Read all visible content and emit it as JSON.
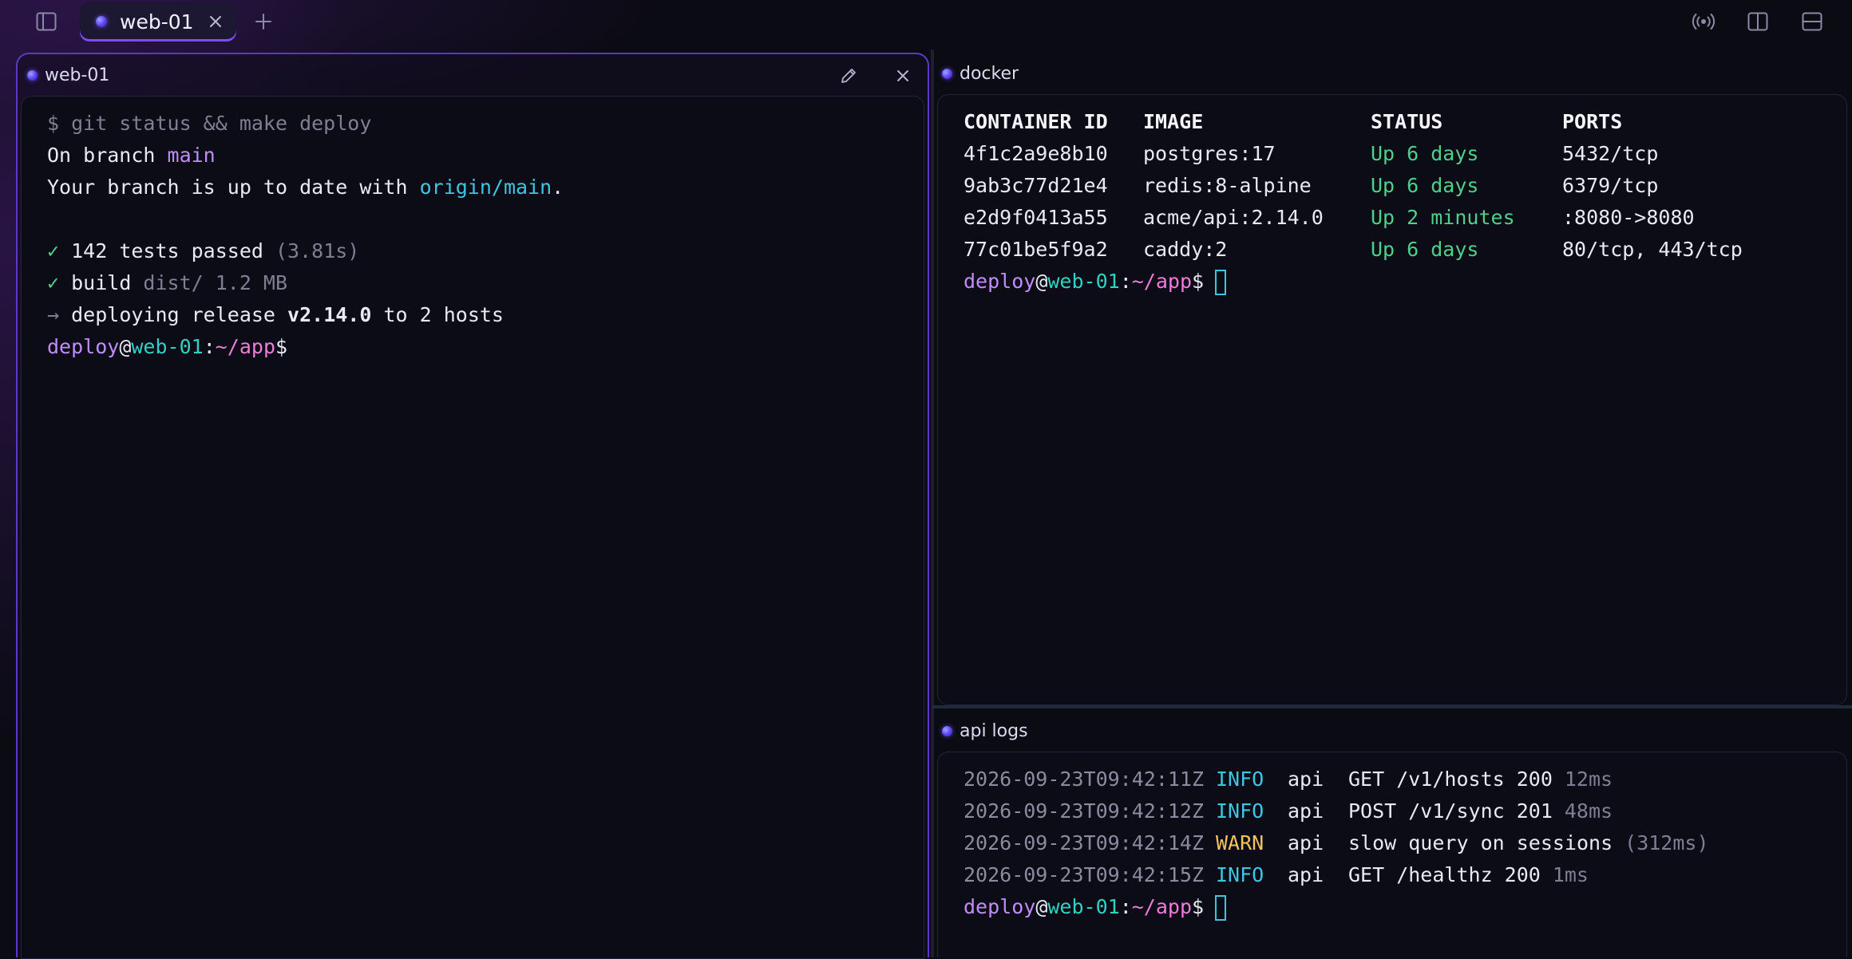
{
  "tabs": [
    {
      "label": "web-01",
      "active": true
    }
  ],
  "topbar": {
    "icons": [
      "sidebar-toggle-icon",
      "plus-icon",
      "broadcast-icon",
      "split-vertical-icon",
      "split-horizontal-icon"
    ]
  },
  "colors": {
    "accent": "#7c4dff",
    "success": "#4fd08a",
    "warn": "#f2c45a",
    "info": "#3ec6e0",
    "prompt_user": "#c18cff",
    "prompt_host": "#2fd1c2",
    "prompt_path": "#f27ad8"
  },
  "prompt": {
    "user": "deploy",
    "at": "@",
    "host": "web-01",
    "colon": ":",
    "path": "~/app",
    "symbol": "$"
  },
  "panes": {
    "left": {
      "title": "web-01",
      "lines": {
        "cmd": "$ git status && make deploy",
        "branch_prefix": "On branch ",
        "branch": "main",
        "uptodate_prefix": "Your branch is up to date with ",
        "remote": "origin/main",
        "uptodate_suffix": ".",
        "tests_check": "✓",
        "tests_text": " 142 tests passed ",
        "tests_time": "(3.81s)",
        "build_check": "✓",
        "build_text": " build ",
        "build_detail": "dist/ 1.2 MB",
        "deploy_arrow": "→",
        "deploy_text1": " deploying release ",
        "deploy_version": "v2.14.0",
        "deploy_text2": " to 2 hosts"
      }
    },
    "docker": {
      "title": "docker",
      "columns": [
        "CONTAINER ID",
        "IMAGE",
        "STATUS",
        "PORTS"
      ],
      "rows": [
        {
          "id": "4f1c2a9e8b10",
          "image": "postgres:17",
          "status": "Up 6 days",
          "ports": "5432/tcp"
        },
        {
          "id": "9ab3c77d21e4",
          "image": "redis:8-alpine",
          "status": "Up 6 days",
          "ports": "6379/tcp"
        },
        {
          "id": "e2d9f0413a55",
          "image": "acme/api:2.14.0",
          "status": "Up 2 minutes",
          "ports": ":8080->8080"
        },
        {
          "id": "77c01be5f9a2",
          "image": "caddy:2",
          "status": "Up 6 days",
          "ports": "80/tcp, 443/tcp"
        }
      ]
    },
    "logs": {
      "title": "api logs",
      "rows": [
        {
          "ts": "2026-09-23T09:42:11Z",
          "level": "INFO",
          "svc": "api",
          "msg": "GET /v1/hosts 200",
          "dur": "12ms"
        },
        {
          "ts": "2026-09-23T09:42:12Z",
          "level": "INFO",
          "svc": "api",
          "msg": "POST /v1/sync 201",
          "dur": "48ms"
        },
        {
          "ts": "2026-09-23T09:42:14Z",
          "level": "WARN",
          "svc": "api",
          "msg": "slow query on sessions",
          "dur": "(312ms)"
        },
        {
          "ts": "2026-09-23T09:42:15Z",
          "level": "INFO",
          "svc": "api",
          "msg": "GET /healthz 200",
          "dur": "1ms"
        }
      ]
    }
  }
}
